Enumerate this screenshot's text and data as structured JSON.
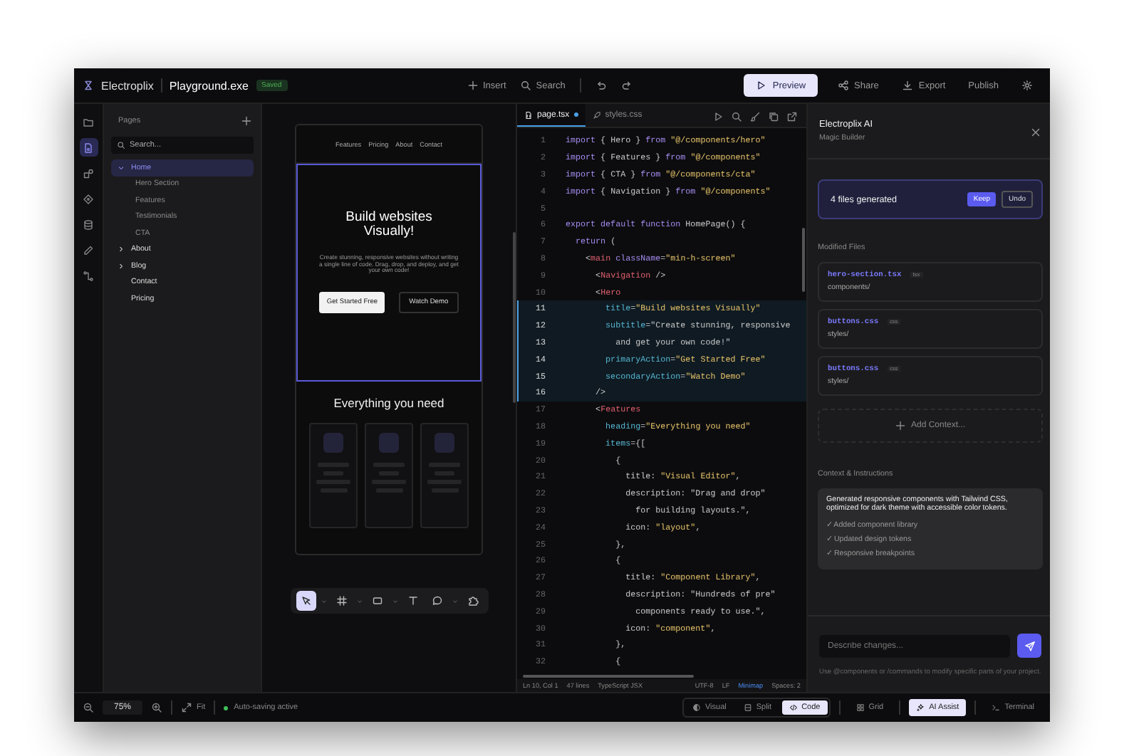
{
  "app": {
    "logo": "Electroplix",
    "file_name": "Playground.exe",
    "save_state": "Saved"
  },
  "toolbar": [
    {
      "kind": "insert",
      "label": "Insert"
    },
    {
      "kind": "search",
      "label": "Search"
    },
    {
      "kind": "undo"
    },
    {
      "kind": "redo"
    }
  ],
  "header_buttons": [
    {
      "kind": "preview",
      "label": "Preview",
      "selected": true
    },
    {
      "kind": "share",
      "label": "Share",
      "selected": false
    },
    {
      "kind": "export",
      "label": "Export",
      "selected": false
    },
    {
      "kind": "publish",
      "label": "Publish",
      "selected": false
    },
    {
      "kind": "settings",
      "selected": false
    }
  ],
  "rail": [
    {
      "kind": "files",
      "selected": false
    },
    {
      "kind": "pages",
      "selected": true
    },
    {
      "kind": "components",
      "selected": false
    },
    {
      "kind": "layers",
      "selected": false
    },
    {
      "kind": "database",
      "selected": false
    },
    {
      "kind": "brush",
      "selected": false
    },
    {
      "kind": "flow",
      "selected": false
    }
  ],
  "pages_panel": {
    "title": "Pages",
    "search": {
      "placeholder": "Search..."
    },
    "tree": [
      {
        "label": "Home",
        "expanded": true,
        "selected": true,
        "children": [
          {
            "label": "Hero Section",
            "selected": false
          },
          {
            "label": "Features",
            "selected": false
          },
          {
            "label": "Testimonials",
            "selected": false
          },
          {
            "label": "CTA",
            "selected": false
          }
        ]
      },
      {
        "label": "About",
        "expanded": false,
        "selected": false
      },
      {
        "label": "Blog",
        "expanded": false,
        "selected": false
      },
      {
        "label": "Contact",
        "selected": false
      },
      {
        "label": "Pricing",
        "selected": false
      }
    ]
  },
  "canvas": {
    "nav_links": [
      "Features",
      "Pricing",
      "About",
      "Contact"
    ],
    "hero": {
      "selected": true,
      "title": "Build websites Visually!",
      "subtitle": "Create stunning, responsive websites without writing a single line of code. Drag, drop, and deploy, and get your own code!",
      "primary_action": "Get Started Free",
      "secondary_action": "Watch Demo"
    },
    "features": {
      "heading": "Everything you need"
    },
    "tools": [
      {
        "kind": "pointer",
        "selected": true,
        "menu": true
      },
      {
        "kind": "frame",
        "selected": false,
        "menu": true
      },
      {
        "kind": "rectangle",
        "selected": false,
        "menu": true
      },
      {
        "kind": "text",
        "selected": false,
        "menu": false
      },
      {
        "kind": "comment",
        "selected": false,
        "menu": true
      },
      {
        "kind": "plugin",
        "selected": false,
        "menu": false
      }
    ]
  },
  "editor": {
    "tabs": [
      {
        "label": "page.tsx",
        "kind": "tsx",
        "modified": true,
        "selected": true
      },
      {
        "label": "styles.css",
        "kind": "css",
        "modified": false,
        "selected": false
      }
    ],
    "actions": [
      {
        "kind": "run"
      },
      {
        "kind": "search"
      },
      {
        "kind": "brush"
      },
      {
        "kind": "copy"
      },
      {
        "kind": "open"
      }
    ],
    "lines": [
      {
        "number": "1",
        "highlighted": false,
        "tokens": [
          {
            "kind": "keyword",
            "text": "import"
          },
          {
            "kind": "plain",
            "text": " { Hero } "
          },
          {
            "kind": "keyword",
            "text": "from"
          },
          {
            "kind": "string",
            "text": " \"@/components/hero\""
          }
        ]
      },
      {
        "number": "2",
        "highlighted": false,
        "tokens": [
          {
            "kind": "keyword",
            "text": "import"
          },
          {
            "kind": "plain",
            "text": " { Features } "
          },
          {
            "kind": "keyword",
            "text": "from"
          },
          {
            "kind": "string",
            "text": " \"@/components\""
          }
        ]
      },
      {
        "number": "3",
        "highlighted": false,
        "tokens": [
          {
            "kind": "keyword",
            "text": "import"
          },
          {
            "kind": "plain",
            "text": " { CTA } "
          },
          {
            "kind": "keyword",
            "text": "from"
          },
          {
            "kind": "string",
            "text": " \"@/components/cta\""
          }
        ]
      },
      {
        "number": "4",
        "highlighted": false,
        "tokens": [
          {
            "kind": "keyword",
            "text": "import"
          },
          {
            "kind": "plain",
            "text": " { Navigation } "
          },
          {
            "kind": "keyword",
            "text": "from"
          },
          {
            "kind": "string",
            "text": " \"@/components\""
          }
        ]
      },
      {
        "number": "5",
        "highlighted": false
      },
      {
        "number": "6",
        "highlighted": false,
        "tokens": [
          {
            "kind": "keyword",
            "text": "export default function"
          },
          {
            "kind": "plain",
            "text": " HomePage() {"
          }
        ]
      },
      {
        "number": "7",
        "highlighted": false,
        "tokens": [
          {
            "kind": "keyword",
            "text": "  return"
          },
          {
            "kind": "plain",
            "text": " ("
          }
        ]
      },
      {
        "number": "8",
        "highlighted": false,
        "tokens": [
          {
            "kind": "plain",
            "text": "    <"
          },
          {
            "kind": "tag",
            "text": "main"
          },
          {
            "kind": "keyword",
            "text": " className"
          },
          {
            "kind": "plain",
            "text": "="
          },
          {
            "kind": "string",
            "text": "\"min-h-screen\""
          }
        ]
      },
      {
        "number": "9",
        "highlighted": false,
        "tokens": [
          {
            "kind": "plain",
            "text": "      <"
          },
          {
            "kind": "tag",
            "text": "Navigation"
          },
          {
            "kind": "plain",
            "text": " />"
          }
        ]
      },
      {
        "number": "10",
        "highlighted": false,
        "tokens": [
          {
            "kind": "plain",
            "text": "      <"
          },
          {
            "kind": "tag",
            "text": "Hero"
          }
        ]
      },
      {
        "number": "11",
        "highlighted": true,
        "tokens": [
          {
            "kind": "attr",
            "text": "        title"
          },
          {
            "kind": "plain",
            "text": "="
          },
          {
            "kind": "string",
            "text": "\"Build websites Visually\""
          }
        ]
      },
      {
        "number": "12",
        "highlighted": true,
        "tokens": [
          {
            "kind": "attr",
            "text": "        subtitle"
          },
          {
            "kind": "plain",
            "text": "=\"Create stunning, responsive"
          }
        ]
      },
      {
        "number": "13",
        "highlighted": true,
        "tokens": [
          {
            "kind": "plain",
            "text": "          and get your own code!\""
          }
        ]
      },
      {
        "number": "14",
        "highlighted": true,
        "tokens": [
          {
            "kind": "attr",
            "text": "        primaryAction"
          },
          {
            "kind": "plain",
            "text": "="
          },
          {
            "kind": "string",
            "text": "\"Get Started Free\""
          }
        ]
      },
      {
        "number": "15",
        "highlighted": true,
        "tokens": [
          {
            "kind": "attr",
            "text": "        secondaryAction"
          },
          {
            "kind": "plain",
            "text": "="
          },
          {
            "kind": "string",
            "text": "\"Watch Demo\""
          }
        ]
      },
      {
        "number": "16",
        "highlighted": true,
        "tokens": [
          {
            "kind": "plain",
            "text": "      />"
          }
        ]
      },
      {
        "number": "17",
        "highlighted": false,
        "tokens": [
          {
            "kind": "plain",
            "text": "      <"
          },
          {
            "kind": "tag",
            "text": "Features"
          }
        ]
      },
      {
        "number": "18",
        "highlighted": false,
        "tokens": [
          {
            "kind": "attr",
            "text": "        heading"
          },
          {
            "kind": "plain",
            "text": "="
          },
          {
            "kind": "string",
            "text": "\"Everything you need\""
          }
        ]
      },
      {
        "number": "19",
        "highlighted": false,
        "tokens": [
          {
            "kind": "attr",
            "text": "        items"
          },
          {
            "kind": "plain",
            "text": "={["
          }
        ]
      },
      {
        "number": "20",
        "highlighted": false,
        "tokens": [
          {
            "kind": "plain",
            "text": "          {"
          }
        ]
      },
      {
        "number": "21",
        "highlighted": false,
        "tokens": [
          {
            "kind": "plain",
            "text": "            title: "
          },
          {
            "kind": "string",
            "text": "\"Visual Editor\""
          },
          {
            "kind": "plain",
            "text": ","
          }
        ]
      },
      {
        "number": "22",
        "highlighted": false,
        "tokens": [
          {
            "kind": "plain",
            "text": "            description: \"Drag and drop\""
          }
        ]
      },
      {
        "number": "23",
        "highlighted": false,
        "tokens": [
          {
            "kind": "plain",
            "text": "              for building layouts.\","
          }
        ]
      },
      {
        "number": "24",
        "highlighted": false,
        "tokens": [
          {
            "kind": "plain",
            "text": "            icon: "
          },
          {
            "kind": "string",
            "text": "\"layout\""
          },
          {
            "kind": "plain",
            "text": ","
          }
        ]
      },
      {
        "number": "25",
        "highlighted": false,
        "tokens": [
          {
            "kind": "plain",
            "text": "          },"
          }
        ]
      },
      {
        "number": "26",
        "highlighted": false,
        "tokens": [
          {
            "kind": "plain",
            "text": "          {"
          }
        ]
      },
      {
        "number": "27",
        "highlighted": false,
        "tokens": [
          {
            "kind": "plain",
            "text": "            title: "
          },
          {
            "kind": "string",
            "text": "\"Component Library\""
          },
          {
            "kind": "plain",
            "text": ","
          }
        ]
      },
      {
        "number": "28",
        "highlighted": false,
        "tokens": [
          {
            "kind": "plain",
            "text": "            description: \"Hundreds of pre\""
          }
        ]
      },
      {
        "number": "29",
        "highlighted": false,
        "tokens": [
          {
            "kind": "plain",
            "text": "              components ready to use.\","
          }
        ]
      },
      {
        "number": "30",
        "highlighted": false,
        "tokens": [
          {
            "kind": "plain",
            "text": "            icon: "
          },
          {
            "kind": "string",
            "text": "\"component\""
          },
          {
            "kind": "plain",
            "text": ","
          }
        ]
      },
      {
        "number": "31",
        "highlighted": false,
        "tokens": [
          {
            "kind": "plain",
            "text": "          },"
          }
        ]
      },
      {
        "number": "32",
        "highlighted": false,
        "tokens": [
          {
            "kind": "plain",
            "text": "          {"
          }
        ]
      }
    ],
    "status": [
      {
        "text": "Ln 10, Col 1",
        "on": false
      },
      {
        "text": "47 lines",
        "on": false
      },
      {
        "text": "TypeScript JSX",
        "on": false
      },
      {
        "text": "UTF-8",
        "on": false
      },
      {
        "text": "LF",
        "on": false
      },
      {
        "text": "Minimap",
        "on": true
      },
      {
        "text": "Spaces: 2",
        "on": false
      }
    ]
  },
  "assistant": {
    "title": "Electroplix AI",
    "subtitle": "Magic Builder",
    "summary": {
      "text": "4 files generated",
      "accept": "Keep",
      "reject": "Undo"
    },
    "files_heading": "Modified Files",
    "files": [
      {
        "name": "hero-section.tsx",
        "type": "tsx",
        "path": "components/"
      },
      {
        "name": "buttons.css",
        "type": "css",
        "path": "styles/"
      },
      {
        "name": "buttons.css",
        "type": "css",
        "path": "styles/"
      }
    ],
    "add_context": "Add Context...",
    "context_heading": "Context & Instructions",
    "message": {
      "text": "Generated responsive components with Tailwind CSS, optimized for dark theme with accessible color tokens.",
      "checks": [
        "✓ Added component library",
        "✓ Updated design tokens",
        "✓ Responsive breakpoints"
      ]
    },
    "input": {
      "placeholder": "Describe changes..."
    },
    "hint": "Use @components or /commands to modify specific parts of your project."
  },
  "bottom_bar": {
    "zoom": "75%",
    "fit": "Fit",
    "autosave": {
      "text": "Auto-saving active",
      "on": true
    },
    "view_modes": [
      {
        "kind": "visual",
        "label": "Visual",
        "selected": false
      },
      {
        "kind": "split",
        "label": "Split",
        "selected": false
      },
      {
        "kind": "code",
        "label": "Code",
        "selected": true
      }
    ],
    "tools": [
      {
        "kind": "grid",
        "label": "Grid",
        "selected": false
      },
      {
        "kind": "ai",
        "label": "AI Assist",
        "selected": true
      },
      {
        "kind": "terminal",
        "label": "Terminal",
        "selected": false
      }
    ]
  }
}
